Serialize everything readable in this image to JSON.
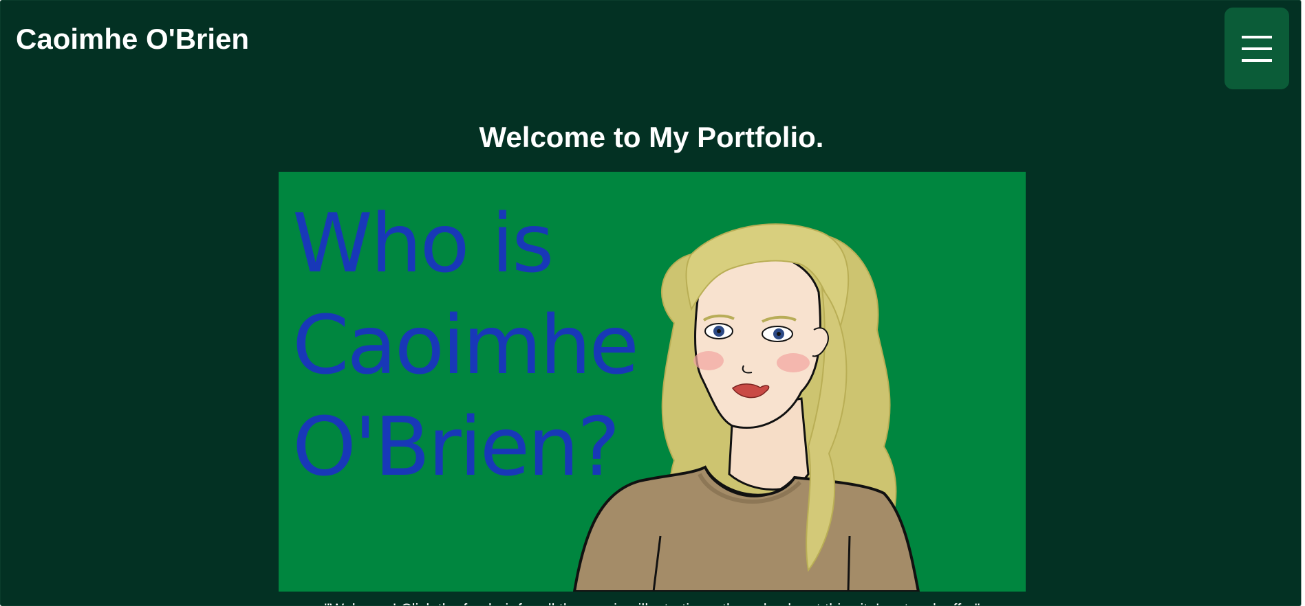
{
  "header": {
    "title": "Caoimhe O'Brien",
    "menu_icon": "hamburger-menu-icon",
    "menu_color": "#0b5c38"
  },
  "main": {
    "heading": "Welcome to My Portfolio.",
    "hero": {
      "text": "Who is Caoimhe O'Brien?",
      "background": "#00863f",
      "text_color": "#1838b8"
    },
    "caption": "\"Welcome! Click the fun hair for all the gaming illustrations, then check out this site's artwork offer\""
  },
  "colors": {
    "page_background": "#033123",
    "text": "#ffffff"
  }
}
